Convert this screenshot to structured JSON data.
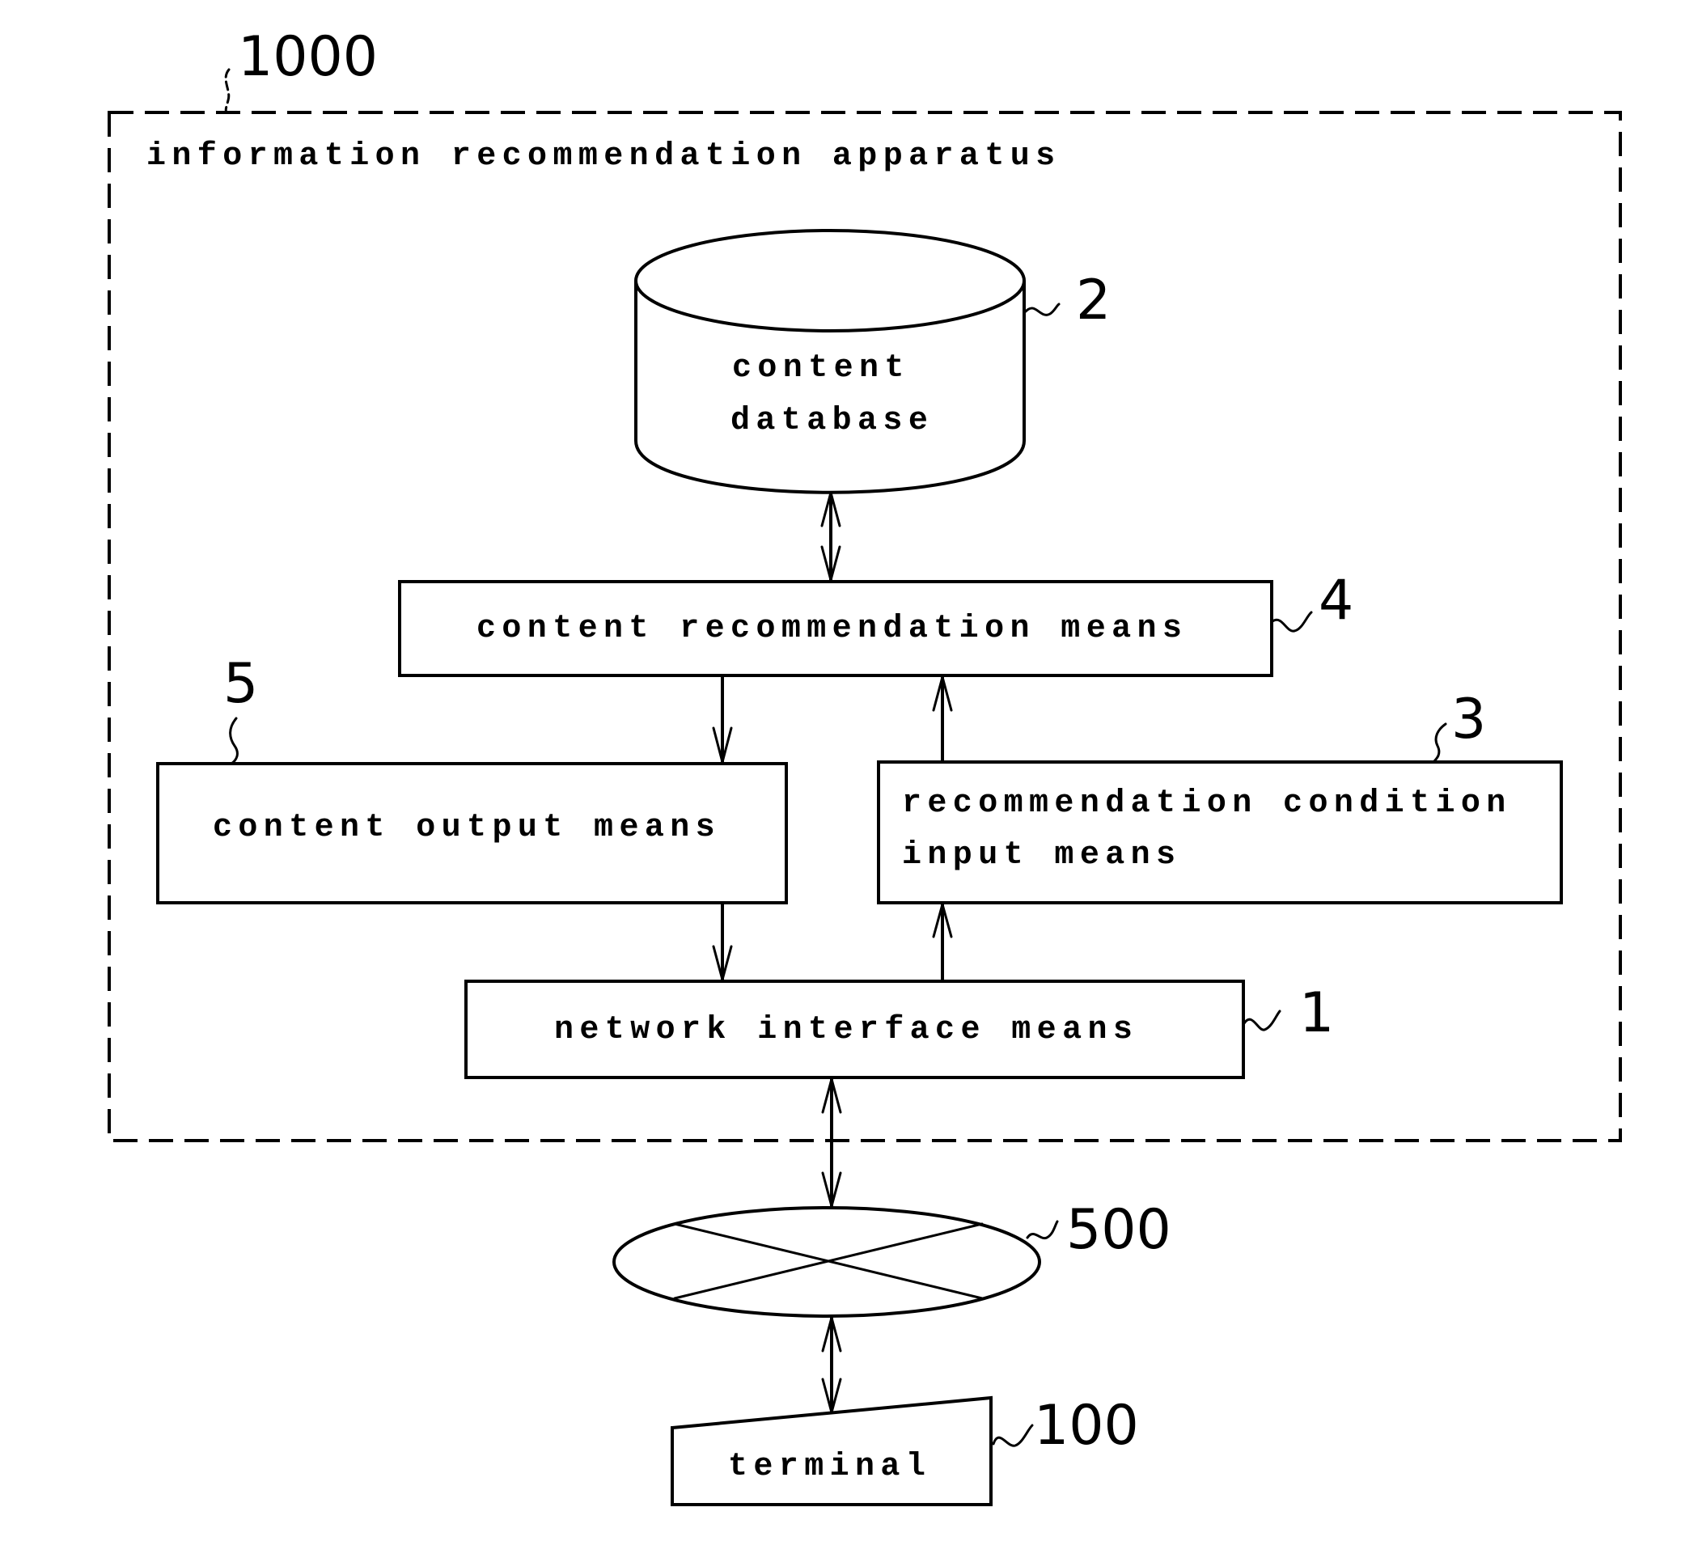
{
  "figure": {
    "container": {
      "ref": "1000",
      "title": "information recommendation apparatus"
    },
    "nodes": {
      "content_database": {
        "ref": "2",
        "line1": "content",
        "line2": "database",
        "shape": "cylinder"
      },
      "content_recommendation": {
        "ref": "4",
        "label": "content recommendation means",
        "shape": "rectangle"
      },
      "content_output": {
        "ref": "5",
        "label": "content output means",
        "shape": "rectangle"
      },
      "recommendation_condition_input": {
        "ref": "3",
        "line1": "recommendation condition",
        "line2": "input means",
        "shape": "rectangle"
      },
      "network_interface": {
        "ref": "1",
        "label": "network interface means",
        "shape": "rectangle"
      },
      "network": {
        "ref": "500",
        "shape": "ellipse-with-cross"
      },
      "terminal": {
        "ref": "100",
        "label": "terminal",
        "shape": "trapezoid"
      }
    },
    "edges": [
      {
        "from": "content_database",
        "to": "content_recommendation",
        "direction": "bidirectional"
      },
      {
        "from": "content_recommendation",
        "to": "content_output",
        "direction": "forward"
      },
      {
        "from": "recommendation_condition_input",
        "to": "content_recommendation",
        "direction": "forward"
      },
      {
        "from": "content_output",
        "to": "network_interface",
        "direction": "forward"
      },
      {
        "from": "network_interface",
        "to": "recommendation_condition_input",
        "direction": "forward"
      },
      {
        "from": "network_interface",
        "to": "network",
        "direction": "bidirectional"
      },
      {
        "from": "network",
        "to": "terminal",
        "direction": "bidirectional"
      }
    ]
  }
}
